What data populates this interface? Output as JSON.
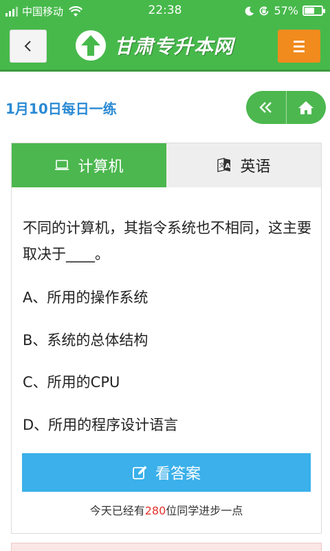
{
  "status_bar": {
    "carrier": "中国移动",
    "time": "22:38",
    "battery_percent": "57%",
    "battery_level": 0.57,
    "icons": [
      "signal-icon",
      "wifi-icon",
      "moon-icon",
      "rotation-lock-icon",
      "battery-icon"
    ]
  },
  "header": {
    "site_name": "甘肃专升本网",
    "back_icon": "chevron-left-icon",
    "menu_icon": "hamburger-icon",
    "colors": {
      "bar": "#47b94b",
      "menu_button": "#f18b1d"
    }
  },
  "page": {
    "title": "1月10日每日一练",
    "nav_icons": [
      "double-chevron-left-icon",
      "home-icon"
    ]
  },
  "tabs": [
    {
      "label": "计算机",
      "icon": "laptop-icon",
      "active": true
    },
    {
      "label": "英语",
      "icon": "translate-icon",
      "active": false
    }
  ],
  "question": {
    "text": "不同的计算机，其指令系统也不相同，这主要取决于____。",
    "options": [
      "A、所用的操作系统",
      "B、系统的总体结构",
      "C、所用的CPU",
      "D、所用的程序设计语言"
    ]
  },
  "answer_button": {
    "label": "看答案",
    "icon": "edit-icon",
    "color": "#3bb0ea"
  },
  "footnote": {
    "prefix": "今天已经有",
    "count": "280",
    "suffix": "位同学进步一点"
  }
}
